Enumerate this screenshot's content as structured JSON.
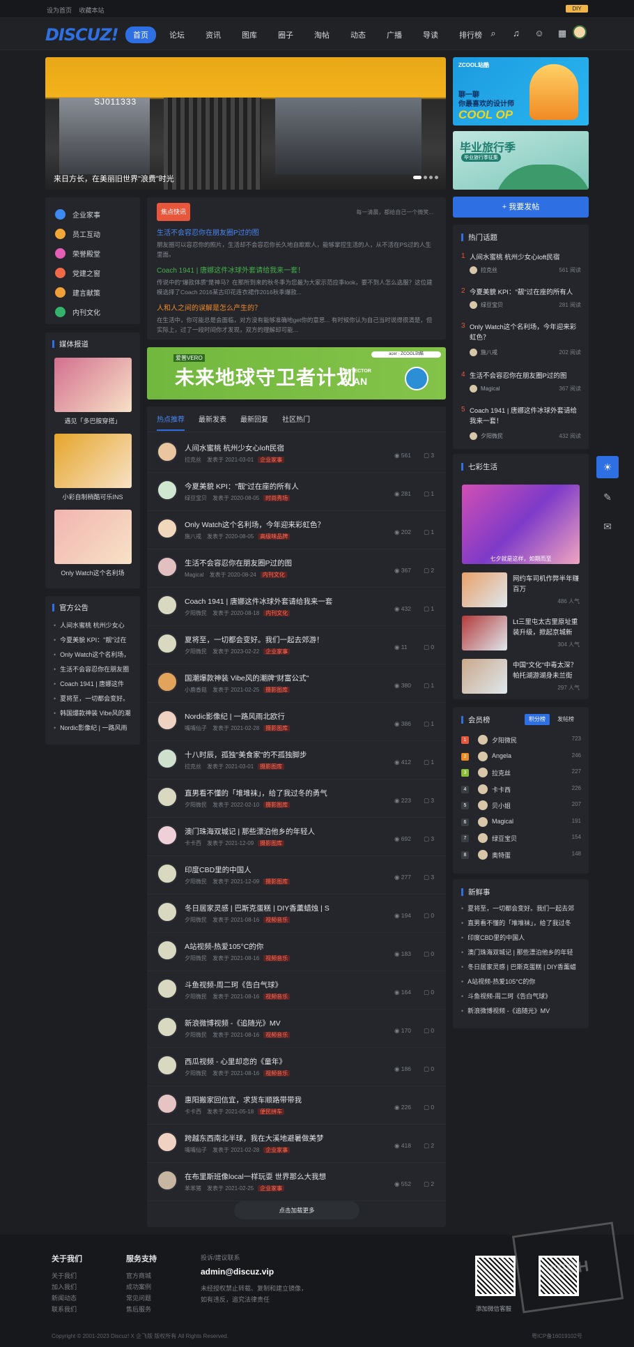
{
  "topbar": {
    "links": [
      "设为首页",
      "收藏本站"
    ],
    "diy": "DIY"
  },
  "nav": {
    "logo": "DISCUZ!",
    "links": [
      "首页",
      "论坛",
      "资讯",
      "图库",
      "圈子",
      "淘帖",
      "动态",
      "广播",
      "导读",
      "排行榜"
    ]
  },
  "slide": {
    "caption": "来日方长，在美丽旧世界\"浪费\"时光",
    "plate": "SJ011333"
  },
  "ads": {
    "ad1_brand": "ZCOOL站酷",
    "ad1_line1": "聊一聊",
    "ad1_line2": "你最喜欢的设计师",
    "ad1_line3": "COOL OP",
    "ad2_title": "毕业旅行季",
    "ad2_sub": "毕业旅行季征集"
  },
  "leftcats": [
    "企业家事",
    "员工互动",
    "荣誉殿堂",
    "党建之窗",
    "建言献策",
    "内刊文化"
  ],
  "leftcat_colors": [
    "#3d8bf0",
    "#f2a838",
    "#e45fb3",
    "#f06a4a",
    "#f0a03a",
    "#33b36b"
  ],
  "hot": {
    "tag": "焦点快讯",
    "sub": "每一清晨，都给自己一个微笑...",
    "items": [
      {
        "title": "生活不会容忍你在朋友圈P过的图",
        "desc": "朋友圈可以容忍你的照片，生活却不会容忍你长久地自欺欺人，能够掌控生活的人，从不活在PS过的人生里面。",
        "color": "#4a86f0"
      },
      {
        "title": "Coach 1941 | 唐娜这件冰球外套请给我来一套！",
        "desc": "传说中的\"爆款体质\"是神马？在那所到来的秋冬季为您最为大家示范应季look，要不到人怎么选服？这位建模选择了Coach 2016某古印花连衣裙作2016秋季爆款...",
        "color": "#45b04a"
      },
      {
        "title": "人和人之间的误解是怎么产生的？",
        "desc": "在生活中，你可能总是会面临，对方没有能够准确地get你的意思... 有时候你认为自己当时说得很清楚，但实际上，过了一段时间你才发现，双方的理解却可能...",
        "color": "#f08a24"
      }
    ]
  },
  "banner": {
    "badge": "爱普VERO",
    "title": "未来地球守卫者计划",
    "plan1": "PROTECTOR",
    "plan2": "PLAN",
    "brand": "acer · ZCOOL站酷"
  },
  "feed": {
    "tabs": [
      "热点推荐",
      "最新发表",
      "最新回复",
      "社区热门"
    ],
    "loadmore": "点击加载更多",
    "rows": [
      {
        "title": "人间水蜜桃 杭州少女心loft民宿",
        "user": "拉克丝",
        "date": "发表于 2021-03-01",
        "cat": "企业家事",
        "views": "561",
        "comments": "3"
      },
      {
        "title": "今夏美貌 KPI：\"靓\"过在座的所有人",
        "user": "绿豆宝贝",
        "date": "发表于 2020-08-05",
        "cat": "时尚秀场",
        "views": "281",
        "comments": "1"
      },
      {
        "title": "Only Watch这个名利场，今年迎来彩虹色？",
        "user": "施八戒",
        "date": "发表于 2020-08-05",
        "cat": "高级味品牌",
        "views": "202",
        "comments": "1"
      },
      {
        "title": "生活不会容忍你在朋友圈P过的图",
        "user": "Magical",
        "date": "发表于 2020-08-24",
        "cat": "内刊文化",
        "views": "367",
        "comments": "2"
      },
      {
        "title": "Coach 1941 | 唐娜这件冰球外套请给我来一套",
        "user": "夕阳微民",
        "date": "发表于 2020-08-18",
        "cat": "内刊文化",
        "views": "432",
        "comments": "1"
      },
      {
        "title": "夏将至，一切都会变好。我们一起去郊游！",
        "user": "夕阳微民",
        "date": "发表于 2023-02-22",
        "cat": "企业家事",
        "views": "11",
        "comments": "0"
      },
      {
        "title": "国潮爆款神装 Vibe风的潮牌\"财富公式\"",
        "user": "小鹿香菇",
        "date": "发表于 2021-02-25",
        "cat": "摄影图库",
        "views": "380",
        "comments": "1"
      },
      {
        "title": "Nordic影像纪 | 一路风雨北欧行",
        "user": "嘴嘴仙子",
        "date": "发表于 2021-02-28",
        "cat": "摄影图库",
        "views": "386",
        "comments": "1"
      },
      {
        "title": "十八时辰，孤独\"美食家\"的不孤独脚步",
        "user": "拉克丝",
        "date": "发表于 2021-03-01",
        "cat": "摄影图库",
        "views": "412",
        "comments": "1"
      },
      {
        "title": "直男看不懂的「堆堆袜」，给了我过冬的勇气",
        "user": "夕阳微民",
        "date": "发表于 2022-02-10",
        "cat": "摄影图库",
        "views": "223",
        "comments": "3"
      },
      {
        "title": "澳门珠海双城记 | 那些漂泊他乡的年轻人",
        "user": "卡卡西",
        "date": "发表于 2021-12-09",
        "cat": "摄影图库",
        "views": "692",
        "comments": "3"
      },
      {
        "title": "印度CBD里的中国人",
        "user": "夕阳微民",
        "date": "发表于 2021-12-09",
        "cat": "摄影图库",
        "views": "277",
        "comments": "3"
      },
      {
        "title": "冬日居家灵感 | 巴斯克蛋糕 | DIY香薰蜡烛 | S",
        "user": "夕阳微民",
        "date": "发表于 2021-08-16",
        "cat": "视频音乐",
        "views": "194",
        "comments": "0"
      },
      {
        "title": "A站视频-热爱105°C的你",
        "user": "夕阳微民",
        "date": "发表于 2021-08-16",
        "cat": "视频音乐",
        "views": "183",
        "comments": "0"
      },
      {
        "title": "斗鱼视频-周二珂《告白气球》",
        "user": "夕阳微民",
        "date": "发表于 2021-08-16",
        "cat": "视频音乐",
        "views": "164",
        "comments": "0"
      },
      {
        "title": "新浪微博视频 -《追随光》MV",
        "user": "夕阳微民",
        "date": "发表于 2021-08-16",
        "cat": "视频音乐",
        "views": "170",
        "comments": "0"
      },
      {
        "title": "西瓜视频 - 心里却恋的《童年》",
        "user": "夕阳微民",
        "date": "发表于 2021-08-16",
        "cat": "视频音乐",
        "views": "186",
        "comments": "0"
      },
      {
        "title": "惠阳搬家回信宜，求货车顺路带带我",
        "user": "卡卡西",
        "date": "发表于 2021-05-18",
        "cat": "便民拼车",
        "views": "226",
        "comments": "0"
      },
      {
        "title": "跨越东西南北半球，我在大溪地避暑做美梦",
        "user": "嘴嘴仙子",
        "date": "发表于 2021-02-28",
        "cat": "企业家事",
        "views": "418",
        "comments": "2"
      },
      {
        "title": "在布里斯班像local一样玩耍 世界那么大我想",
        "user": "苯苯猪",
        "date": "发表于 2021-02-25",
        "cat": "企业家事",
        "views": "552",
        "comments": "2"
      }
    ]
  },
  "media": {
    "title": "媒体报道",
    "items": [
      {
        "cap": "遇见「多巴胺穿搭」",
        "color": "#d36f8f"
      },
      {
        "cap": "小彩自制稍酷可乐INS",
        "color": "#e6a52b"
      },
      {
        "cap": "Only Watch这个名利场",
        "color": "#f2b4b0"
      }
    ]
  },
  "notice": {
    "title": "官方公告",
    "items": [
      "人间水蜜桃 杭州少女心",
      "今夏美貌 KPI：\"靓\"过在",
      "Only Watch这个名利场，",
      "生活不会容忍你在朋友圈",
      "Coach 1941 | 唐娜这件",
      "夏将至，一切都会变好。",
      "韩国爆款神装 Vibe风的潮",
      "Nordic影像纪 | 一路风雨"
    ]
  },
  "post_btn": "+ 我要发帖",
  "hotposts": {
    "title": "热门话题",
    "items": [
      {
        "n": "1",
        "t": "人间水蜜桃 杭州少女心loft民宿",
        "u": "拉克丝",
        "r": "561 阅读"
      },
      {
        "n": "2",
        "t": "今夏美貌 KPI：\"靓\"过在座的所有人",
        "u": "绿豆宝贝",
        "r": "281 阅读"
      },
      {
        "n": "3",
        "t": "Only Watch这个名利场，今年迎来彩虹色？",
        "u": "施八戒",
        "r": "202 阅读"
      },
      {
        "n": "4",
        "t": "生活不会容忍你在朋友圈P过的图",
        "u": "Magical",
        "r": "367 阅读"
      },
      {
        "n": "5",
        "t": "Coach 1941 | 唐娜这件冰球外套请给我来一套！",
        "u": "夕阳微民",
        "r": "432 阅读"
      }
    ]
  },
  "life": {
    "title": "七彩生活",
    "big_cap": "七夕就是这样，如期而至",
    "items": [
      {
        "t": "网约车司机作弊半年赚百万",
        "p": "486 人气",
        "c": "#e8a06a"
      },
      {
        "t": "Lt三里屯太古里原址重装升级，掀起京城新",
        "p": "304 人气",
        "c": "#b33a3a"
      },
      {
        "t": "中国\"文化\"中毒太深？帕托湖游湖身未兰街",
        "p": "297 人气",
        "c": "#caa88a"
      }
    ]
  },
  "rank": {
    "title": "会员榜",
    "tab1": "积分榜",
    "tab2": "发帖榜",
    "rows": [
      {
        "n": "1",
        "name": "夕阳微民",
        "v": "723",
        "c": "#e8573c"
      },
      {
        "n": "2",
        "name": "Angela",
        "v": "246",
        "c": "#f08a24"
      },
      {
        "n": "3",
        "name": "拉克丝",
        "v": "227",
        "c": "#8bbf3a"
      },
      {
        "n": "4",
        "name": "卡卡西",
        "v": "226",
        "c": "#3a3d42"
      },
      {
        "n": "5",
        "name": "贝小姐",
        "v": "207",
        "c": "#3a3d42"
      },
      {
        "n": "6",
        "name": "Magical",
        "v": "191",
        "c": "#3a3d42"
      },
      {
        "n": "7",
        "name": "绿豆宝贝",
        "v": "154",
        "c": "#3a3d42"
      },
      {
        "n": "8",
        "name": "奥特蛋",
        "v": "148",
        "c": "#3a3d42"
      }
    ]
  },
  "newest": {
    "title": "新鲜事",
    "items": [
      "夏将至，一切都会变好。我们一起去郊",
      "直男看不懂的「堆堆袜」，给了我过冬",
      "印度CBD里的中国人",
      "澳门珠海双城记 | 那些漂泊他乡的年轻",
      "冬日居家灵感 | 巴斯克蛋糕 | DIY香薰蜡",
      "A站视频-热爱105°C的你",
      "斗鱼视频-周二珂《告白气球》",
      "新浪微博视频 -《追随光》MV"
    ]
  },
  "footer": {
    "about": {
      "h": "关于我们",
      "links": [
        "关于我们",
        "加入我们",
        "新闻动态",
        "联系我们"
      ]
    },
    "support": {
      "h": "服务支持",
      "links": [
        "官方商城",
        "成功案例",
        "常见问题",
        "售后服务"
      ]
    },
    "contact": {
      "h": "投诉/建议联系",
      "mail": "admin@discuz.vip",
      "note1": "未经授权禁止转载、复制和建立镜像，",
      "note2": "如有违反，追究法律责任"
    },
    "qr_cap": "添加微信客服",
    "copy": "Copyright © 2001-2023 Discuz! X 企飞版 版权所有 All Rights Reserved.",
    "icp": "粤ICP备16019102号",
    "watermark": "TECH"
  }
}
